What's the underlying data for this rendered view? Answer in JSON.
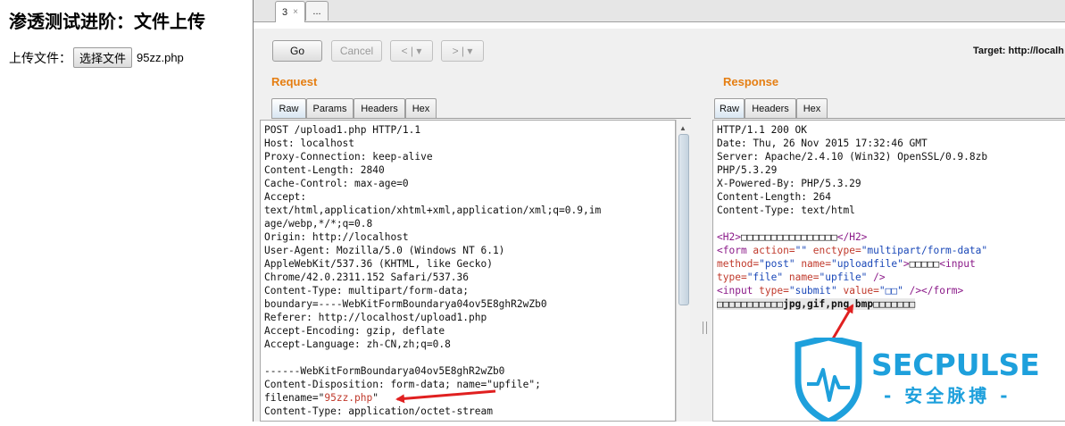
{
  "browser_page": {
    "title": "渗透测试进阶：文件上传",
    "upload_label": "上传文件：",
    "file_button": "选择文件",
    "file_name": "95zz.php"
  },
  "repeater": {
    "tabs": [
      {
        "label": "3",
        "close": "×"
      },
      {
        "label": "..."
      }
    ],
    "toolbar": {
      "go": "Go",
      "cancel": "Cancel",
      "back": "<",
      "forward": ">",
      "dropdown": "▾",
      "target_label": "Target: http://localh"
    }
  },
  "request": {
    "title": "Request",
    "tabs": [
      "Raw",
      "Params",
      "Headers",
      "Hex"
    ],
    "lines": [
      "POST /upload1.php HTTP/1.1",
      "Host: localhost",
      "Proxy-Connection: keep-alive",
      "Content-Length: 2840",
      "Cache-Control: max-age=0",
      "Accept:",
      "text/html,application/xhtml+xml,application/xml;q=0.9,im",
      "age/webp,*/*;q=0.8",
      "Origin: http://localhost",
      "User-Agent: Mozilla/5.0 (Windows NT 6.1)",
      "AppleWebKit/537.36 (KHTML, like Gecko)",
      "Chrome/42.0.2311.152 Safari/537.36",
      "Content-Type: multipart/form-data;",
      "boundary=----WebKitFormBoundarya04ov5E8ghR2wZb0",
      "Referer: http://localhost/upload1.php",
      "Accept-Encoding: gzip, deflate",
      "Accept-Language: zh-CN,zh;q=0.8",
      "",
      "------WebKitFormBoundarya04ov5E8ghR2wZb0",
      "Content-Disposition: form-data; name=\"upfile\";"
    ],
    "filename_prefix": "filename=\"",
    "filename_value": "95zz.php",
    "filename_suffix": "\"",
    "last_line": "Content-Type: application/octet-stream"
  },
  "response": {
    "title": "Response",
    "tabs": [
      "Raw",
      "Headers",
      "Hex"
    ],
    "headers": [
      "HTTP/1.1 200 OK",
      "Date: Thu, 26 Nov 2015 17:32:46 GMT",
      "Server: Apache/2.4.10 (Win32) OpenSSL/0.9.8zb",
      "PHP/5.3.29",
      "X-Powered-By: PHP/5.3.29",
      "Content-Length: 264",
      "Content-Type: text/html"
    ],
    "html": {
      "h2_open": "<H2>",
      "h2_text": "□□□□□□□□□□□□□□□□",
      "h2_close": "</H2>",
      "form_open": "<form",
      "action_attr": " action=",
      "action_val": "\"\"",
      "enctype_attr": " enctype=",
      "enctype_val": "\"multipart/form-data\"",
      "method_attr": "method=",
      "method_val": "\"post\"",
      "name_attr": " name=",
      "name_val": "\"uploadfile\"",
      "form_close_bracket": ">",
      "label_text": "□□□□□",
      "input1_open": "<input",
      "type_attr": "type=",
      "type_val": "\"file\"",
      "name2_attr": " name=",
      "name2_val": "\"upfile\"",
      "input1_close": " />",
      "input2_open": "<input",
      "type2_attr": " type=",
      "type2_val": "\"submit\"",
      "value_attr": " value=",
      "value_val": "\"□□\"",
      "input2_close": " /></form>",
      "msg_text": "□□□□□□□□□□□jpg,gif,png,bmp□□□□□□□"
    }
  },
  "watermark": {
    "brand": "SECPULSE",
    "sub": "- 安全脉搏 -"
  }
}
